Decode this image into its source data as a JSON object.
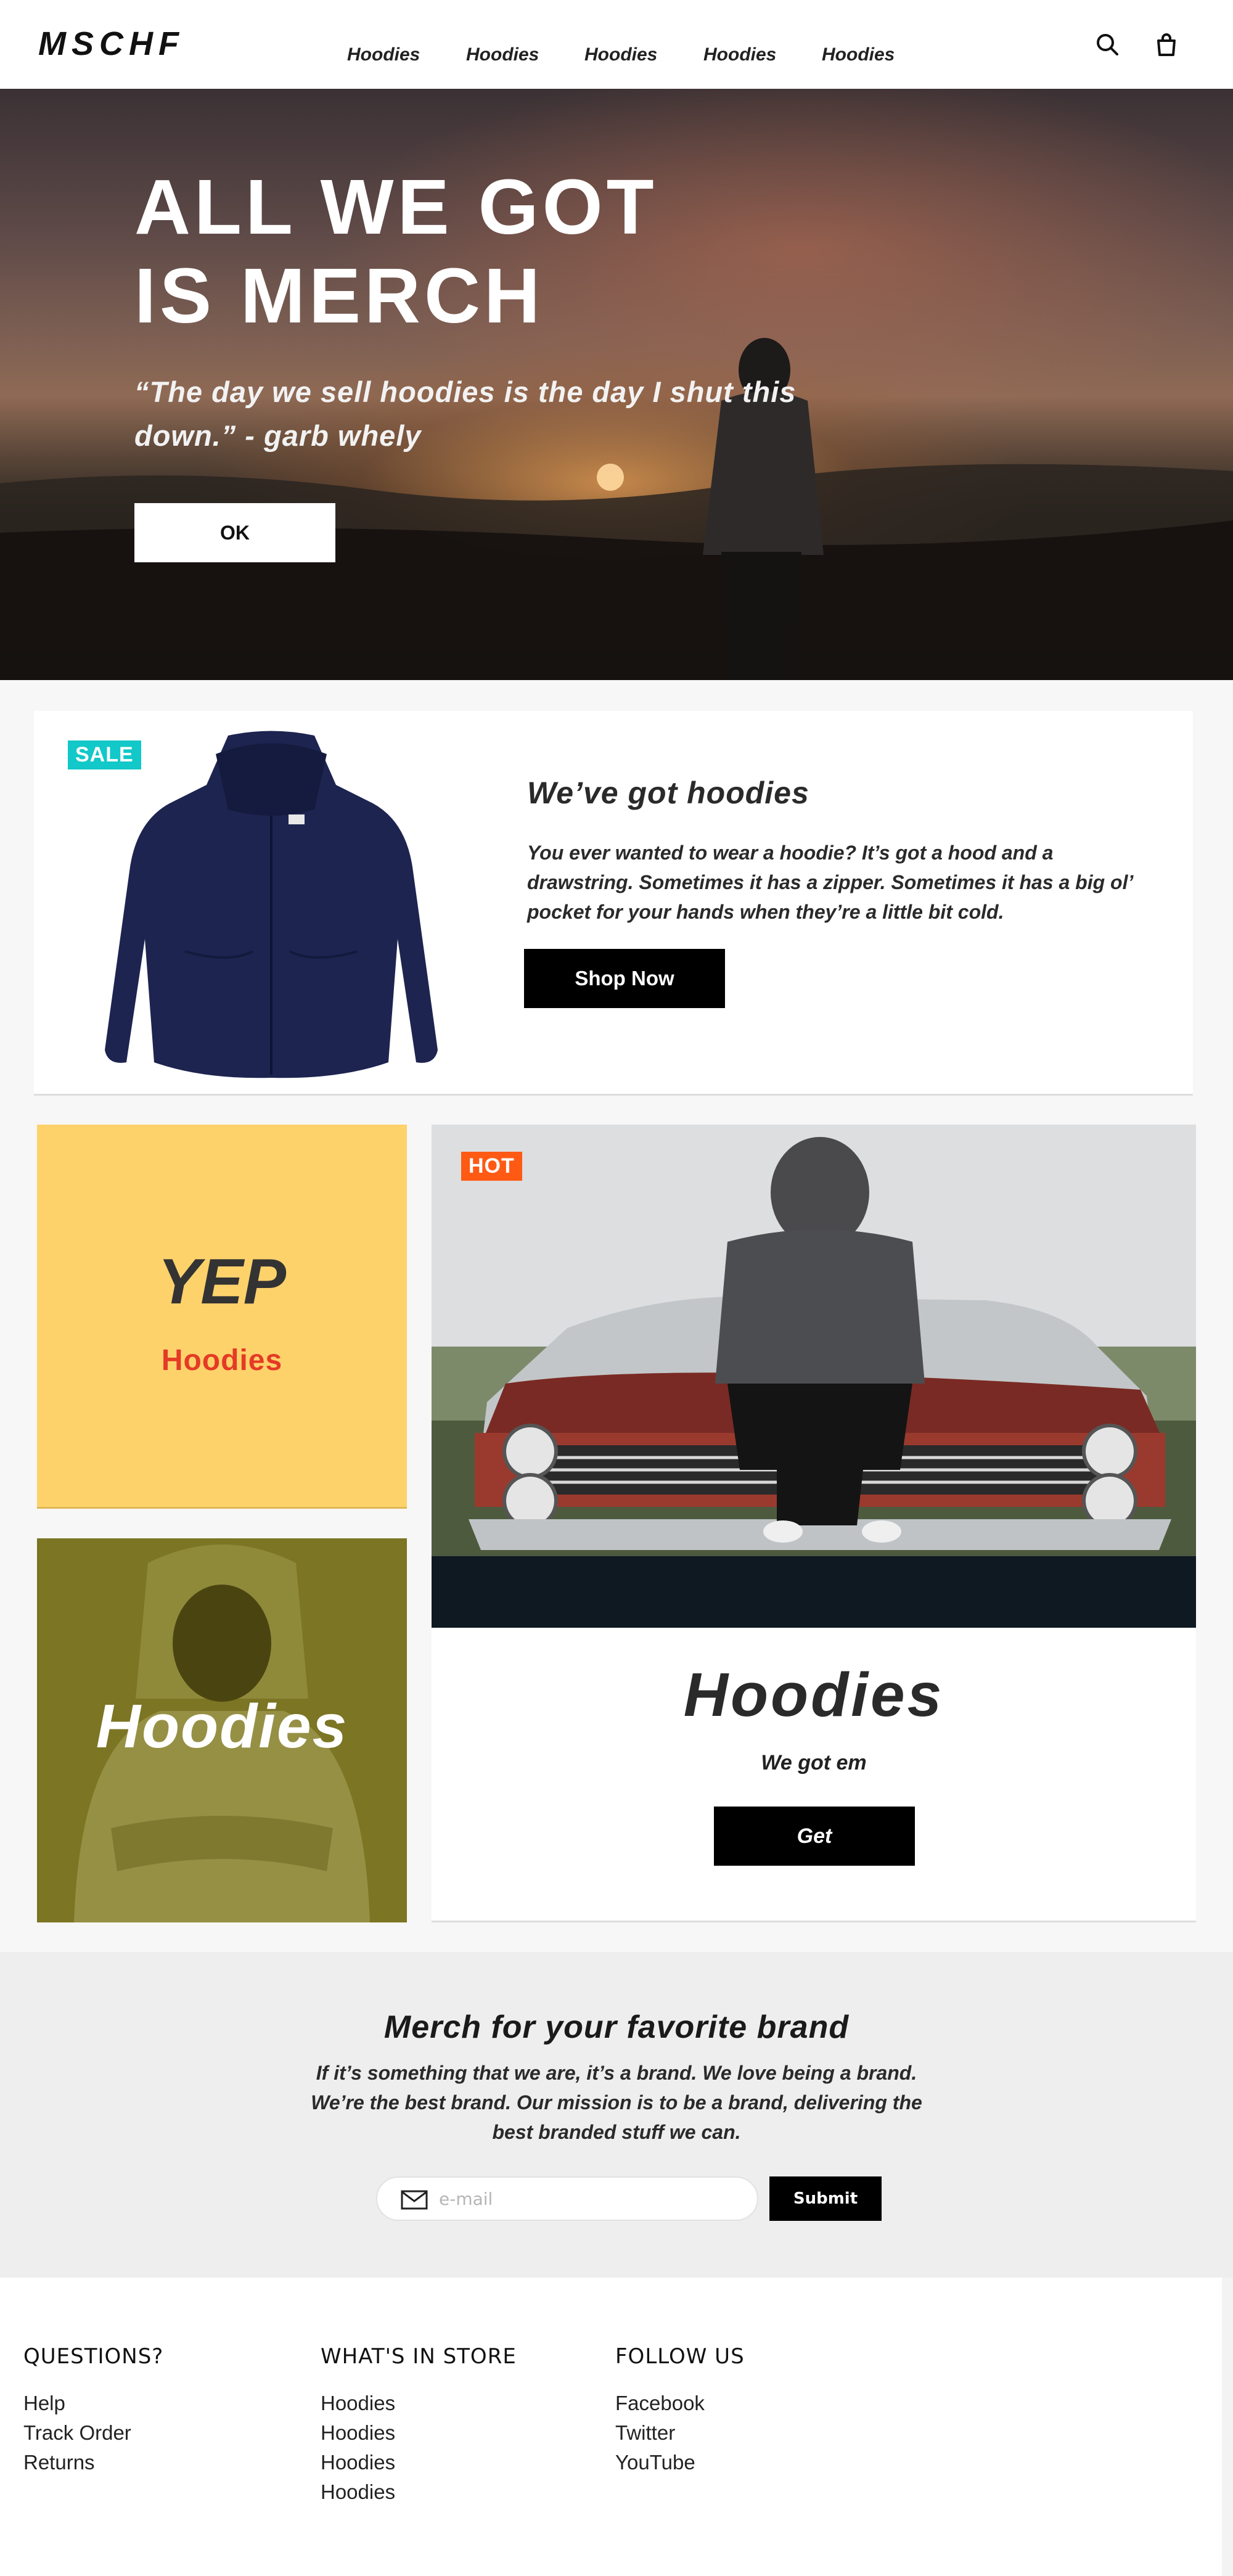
{
  "header": {
    "logo": "MSCHF",
    "nav": [
      "Hoodies",
      "Hoodies",
      "Hoodies",
      "Hoodies",
      "Hoodies"
    ],
    "icons": [
      "search-icon",
      "shopping-bag-icon"
    ]
  },
  "hero": {
    "title_line1": "ALL WE GOT",
    "title_line2": "IS MERCH",
    "quote": "“The day we sell hoodies is the day I shut this down.” - garb whely",
    "button": "OK"
  },
  "featured": {
    "badge": "SALE",
    "title": "We’ve got hoodies",
    "body": "You ever wanted to wear a hoodie? It’s got a hood and a drawstring. Sometimes it has a zipper. Sometimes it has a big ol’ pocket for your hands when they’re a little bit cold.",
    "button": "Shop Now"
  },
  "promo_yep": {
    "title": "YEP",
    "subtitle": "Hoodies"
  },
  "promo_olive": {
    "title": "Hoodies"
  },
  "promo_hot": {
    "badge": "HOT",
    "title": "Hoodies",
    "subtitle": "We got em",
    "button": "Get"
  },
  "newsletter": {
    "title": "Merch for your favorite brand",
    "body": "If it’s something that we are, it’s a brand. We love being a brand. We’re the best brand. Our mission is to be a brand, delivering the best branded stuff we can.",
    "email_placeholder": "e-mail",
    "button": "Submit"
  },
  "footer": {
    "columns": [
      {
        "heading": "QUESTIONS?",
        "links": [
          "Help",
          "Track Order",
          "Returns"
        ]
      },
      {
        "heading": "WHAT'S IN STORE",
        "links": [
          "Hoodies",
          "Hoodies",
          "Hoodies",
          "Hoodies"
        ]
      },
      {
        "heading": "FOLLOW US",
        "links": [
          "Facebook",
          "Twitter",
          "YouTube"
        ]
      }
    ]
  },
  "colors": {
    "sale_badge": "#12c8c8",
    "hot_badge": "#ff5a14",
    "yep_tile": "#fed26b",
    "yep_accent": "#e43a26",
    "olive_tile": "#7b7524",
    "button_dark": "#000000"
  }
}
